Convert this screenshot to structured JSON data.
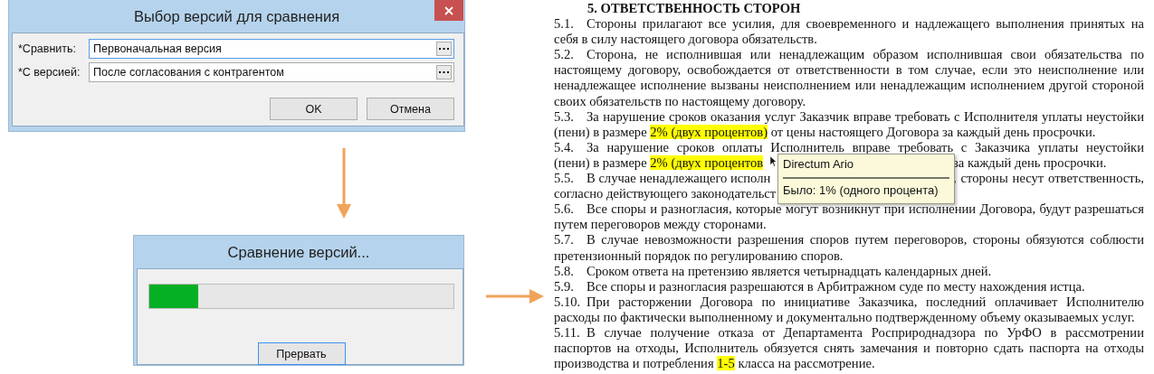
{
  "select_dialog": {
    "title": "Выбор версий для сравнения",
    "fields": [
      {
        "label": "*Сравнить:",
        "value": "Первоначальная версия",
        "focused": true
      },
      {
        "label": "*С версией:",
        "value": "После согласования с контрагентом",
        "focused": false
      }
    ],
    "buttons": [
      "OK",
      "Отмена"
    ]
  },
  "progress_dialog": {
    "title": "Сравнение версий...",
    "progress": {
      "level": 0.16
    },
    "button": "Прервать"
  },
  "document": {
    "heading": "5. ОТВЕТСТВЕННОСТЬ СТОРОН",
    "clauses": [
      {
        "number": "5.1.",
        "lines": [
          {
            "kind": "full",
            "segments": [
              {
                "text": "Стороны прилагают все усилия, для своевременного и надлежащего выполнения принятых на",
                "highlight": false
              }
            ]
          },
          {
            "kind": "full",
            "segments": [
              {
                "text": "себя в силу настоящего договора обязательств.",
                "highlight": false
              }
            ]
          }
        ]
      },
      {
        "number": "5.2.",
        "lines": [
          {
            "kind": "full",
            "segments": [
              {
                "text": "Сторона, не исполнившая или ненадлежащим образом исполнившая свои обязательства по",
                "highlight": false
              }
            ]
          },
          {
            "kind": "full",
            "segments": [
              {
                "text": "настоящему договору, освобождается от ответственности в том случае, если это неисполнение или",
                "highlight": false
              }
            ]
          },
          {
            "kind": "full",
            "segments": [
              {
                "text": "ненадлежащее исполнение вызваны неисполнением или ненадлежащим исполнением другой стороной",
                "highlight": false
              }
            ]
          },
          {
            "kind": "full",
            "segments": [
              {
                "text": "своих обязательств по настоящему договору.",
                "highlight": false
              }
            ]
          }
        ]
      },
      {
        "number": "5.3.",
        "lines": [
          {
            "kind": "full",
            "segments": [
              {
                "text": "За нарушение сроков оказания услуг Заказчик вправе требовать с Исполнителя уплаты неустойки",
                "highlight": false
              }
            ]
          },
          {
            "kind": "full",
            "segments": [
              {
                "text": "(пени) в размере",
                "highlight": false
              },
              {
                "text": "2% (двух процентов)",
                "highlight": true
              },
              {
                "text": "от цены настоящего Договора за каждый день просрочки.",
                "highlight": false
              }
            ]
          }
        ]
      },
      {
        "number": "5.4.",
        "lines": [
          {
            "kind": "full",
            "segments": [
              {
                "text": "За нарушение сроков оплаты Исполнитель вправе требовать с Заказчика уплаты неустойки",
                "highlight": false
              }
            ]
          },
          {
            "kind": "split",
            "left": [
              {
                "text": "(пени) в размере",
                "highlight": false
              },
              {
                "text": "2% (двух процентов",
                "highlight": true
              }
            ],
            "right": [
              {
                "text": "за каждый день просрочки.",
                "highlight": false
              }
            ]
          }
        ]
      },
      {
        "number": "5.5.",
        "lines": [
          {
            "kind": "split",
            "left": [
              {
                "text": "В случае ненадлежащего исполн",
                "highlight": false
              }
            ],
            "right": [
              {
                "text": ", стороны несут ответственность,",
                "highlight": false
              }
            ]
          },
          {
            "kind": "split",
            "left": [
              {
                "text": "согласно действующего законодательст",
                "highlight": false
              }
            ]
          }
        ]
      },
      {
        "number": "5.6.",
        "lines": [
          {
            "kind": "full",
            "segments": [
              {
                "text": "Все споры и разногласия, которые могут возникнут при исполнении Договора, будут разрешаться",
                "highlight": false
              }
            ]
          },
          {
            "kind": "full",
            "segments": [
              {
                "text": "путем переговоров между сторонами.",
                "highlight": false
              }
            ]
          }
        ]
      },
      {
        "number": "5.7.",
        "lines": [
          {
            "kind": "full",
            "segments": [
              {
                "text": "В случае невозможности разрешения споров путем переговоров, стороны обязуются соблюсти",
                "highlight": false
              }
            ]
          },
          {
            "kind": "full",
            "segments": [
              {
                "text": "претензионный порядок по регулированию споров.",
                "highlight": false
              }
            ]
          }
        ]
      },
      {
        "number": "5.8.",
        "lines": [
          {
            "kind": "full",
            "segments": [
              {
                "text": "Сроком ответа на претензию является четырнадцать календарных дней.",
                "highlight": false
              }
            ]
          }
        ]
      },
      {
        "number": "5.9.",
        "lines": [
          {
            "kind": "full",
            "segments": [
              {
                "text": "Все споры и разногласия разрешаются в Арбитражном суде по месту нахождения истца.",
                "highlight": false
              }
            ]
          }
        ]
      },
      {
        "number": "5.10.",
        "lines": [
          {
            "kind": "full",
            "segments": [
              {
                "text": "При расторжении Договора по инициативе Заказчика, последний оплачивает Исполнителю",
                "highlight": false
              }
            ]
          },
          {
            "kind": "full",
            "segments": [
              {
                "text": "расходы по фактически выполненному и документально подтвержденному объему оказываемых услуг.",
                "highlight": false
              }
            ]
          }
        ]
      },
      {
        "number": "5.11.",
        "lines": [
          {
            "kind": "full",
            "segments": [
              {
                "text": "В случае получение отказа от Департамента Росприроднадзора по УрФО в рассмотрении",
                "highlight": false
              }
            ]
          },
          {
            "kind": "full",
            "segments": [
              {
                "text": "паспортов на отходы, Исполнитель обязуется снять замечания и повторно сдать паспорта на отходы",
                "highlight": false
              }
            ]
          },
          {
            "kind": "full",
            "segments": [
              {
                "text": "производства и потребления",
                "highlight": false
              },
              {
                "text": "1-5",
                "highlight": true
              },
              {
                "text": "класса на рассмотрение.",
                "highlight": false
              }
            ]
          }
        ]
      }
    ]
  },
  "tooltip": {
    "title": "Directum Ario",
    "text": "Было: 1% (одного процента)"
  }
}
